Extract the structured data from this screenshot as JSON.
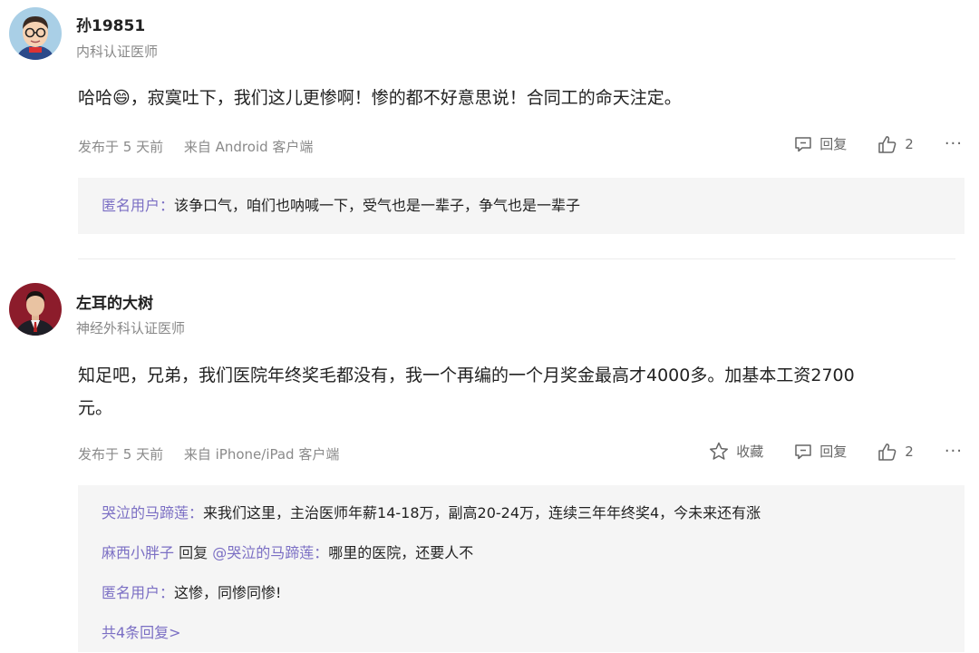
{
  "posts": [
    {
      "username": "孙19851",
      "title": "内科认证医师",
      "content": "哈哈😄，寂寞吐下，我们这儿更惨啊！惨的都不好意思说！合同工的命天注定。",
      "time": "发布于 5 天前",
      "source": "来自 Android 客户端",
      "reply_label": "回复",
      "like_count": "2",
      "more": "···",
      "replies": [
        {
          "name": "匿名用户：",
          "text": "该争口气，咱们也呐喊一下，受气也是一辈子，争气也是一辈子"
        }
      ]
    },
    {
      "username": "左耳的大树",
      "title": "神经外科认证医师",
      "content_line1": "知足吧，兄弟，我们医院年终奖毛都没有，我一个再编的一个月奖金最高才4000多。加基本工资2700",
      "content_line2": "元。",
      "time": "发布于 5 天前",
      "source": "来自 iPhone/iPad 客户端",
      "favorite_label": "收藏",
      "reply_label": "回复",
      "like_count": "2",
      "more": "···",
      "replies": [
        {
          "name": "哭泣的马蹄莲：",
          "text": "来我们这里，主治医师年薪14-18万，副高20-24万，连续三年年终奖4，今未来还有涨"
        },
        {
          "name": "麻西小胖子",
          "word": " 回复 ",
          "target": "@哭泣的马蹄莲：",
          "text": "哪里的医院，还要人不"
        },
        {
          "name": "匿名用户：",
          "text": "这惨，同惨同惨!"
        }
      ],
      "more_replies": "共4条回复>"
    }
  ]
}
